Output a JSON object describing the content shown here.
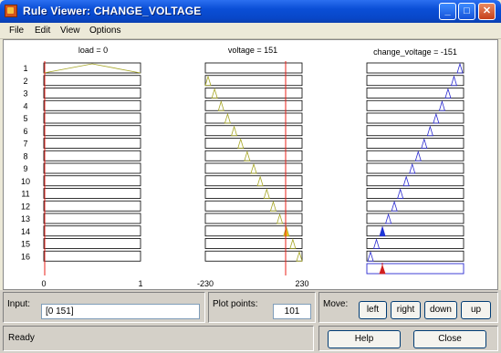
{
  "window": {
    "title": "Rule Viewer: CHANGE_VOLTAGE"
  },
  "menu": [
    "File",
    "Edit",
    "View",
    "Options"
  ],
  "colors": {
    "input_line": "#e8201a",
    "input_mf": "#a6a625",
    "output_mf": "#2b2bd0",
    "fill_in": "#f4c51c",
    "fill_out": "#1a3ad8",
    "aggregate": "#d21f1f"
  },
  "headers": {
    "load": "load = 0",
    "voltage": "voltage = 151",
    "change_voltage": "change_voltage = -151"
  },
  "rules": [
    "1",
    "2",
    "3",
    "4",
    "5",
    "6",
    "7",
    "8",
    "9",
    "10",
    "11",
    "12",
    "13",
    "14",
    "15",
    "16"
  ],
  "axes": {
    "load": {
      "min": "0",
      "max": "1"
    },
    "voltage": {
      "min": "-230",
      "max": "230"
    }
  },
  "controls": {
    "input_label": "Input:",
    "input_value": "[0 151]",
    "plot_points_label": "Plot points:",
    "plot_points_value": "101",
    "move_label": "Move:",
    "move_buttons": [
      "left",
      "right",
      "down",
      "up"
    ],
    "help": "Help",
    "close": "Close",
    "status": "Ready"
  }
}
